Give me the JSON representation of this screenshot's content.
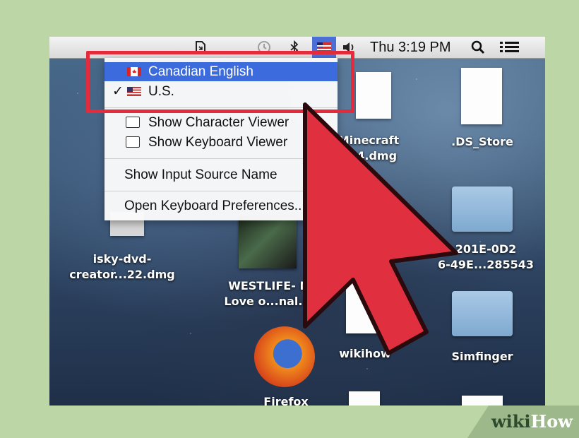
{
  "menubar": {
    "time": "Thu 3:19 PM",
    "icons": [
      "document-icon",
      "time-machine-icon",
      "bluetooth-icon",
      "input-flag-icon",
      "volume-icon",
      "spotlight-icon",
      "notification-list-icon"
    ]
  },
  "input_menu": {
    "items": [
      {
        "label": "Canadian English",
        "flag": "canada-flag-icon",
        "selected": false,
        "highlighted": true
      },
      {
        "label": "U.S.",
        "flag": "us-flag-icon",
        "selected": true,
        "highlighted": false
      }
    ],
    "check_mark": "✓",
    "viewer_items": [
      "Show Character Viewer",
      "Show Keyboard Viewer"
    ],
    "show_source_name": "Show Input Source Name",
    "open_prefs": "Open Keyboard Preferences..."
  },
  "desktop": {
    "minecraft": "Minecraft\n.6.4.dmg",
    "ds_store": ".DS_Store",
    "folder_201e": "201E-0D2\n6-49E...285543",
    "isky": "isky-dvd-\ncreator...22.dmg",
    "westlife": "WESTLIFE- My\nLove o...nal.mp",
    "wikihow": "wikihow",
    "simfinger": "Simfinger",
    "firefox": "Firefox"
  },
  "watermark": {
    "wiki": "wiki",
    "how": "How"
  },
  "colors": {
    "highlight": "#3b6bdc",
    "annotation_red": "#e32b3c",
    "frame_bg": "#bcd6a6"
  }
}
